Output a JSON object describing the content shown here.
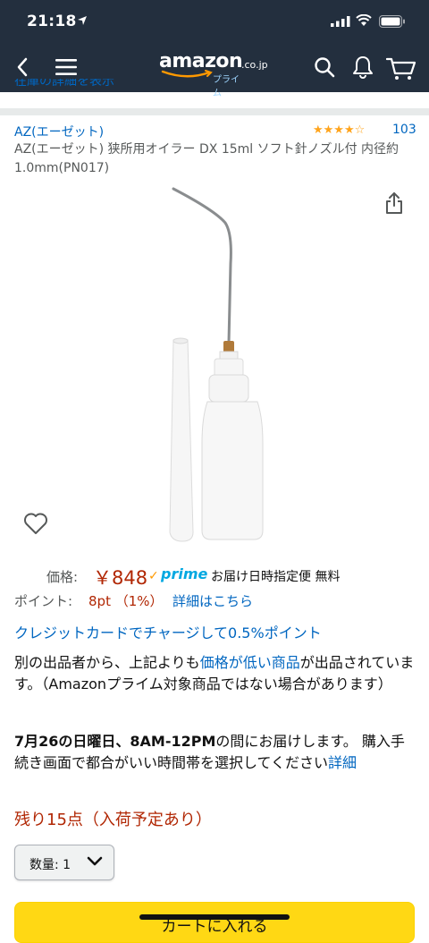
{
  "status_bar": {
    "time": "21:18"
  },
  "nav": {
    "logo_text": "amazon",
    "logo_tld": ".co.jp",
    "logo_sub": "プライム",
    "clipped_link": "在庫の詳細を表示"
  },
  "product": {
    "brand": "AZ(エーゼット)",
    "rating_stars": "★★★★☆",
    "rating_count": "103",
    "title": "AZ(エーゼット) 狭所用オイラー DX 15ml ソフト針ノズル付 内径約1.0mm(PN017)"
  },
  "price": {
    "label": "価格:",
    "value": "￥848",
    "prime_check": "✓",
    "prime_label": "prime",
    "delivery_note": "お届け日時指定便 無料"
  },
  "points": {
    "label": "ポイント:",
    "value": "8pt （1%）",
    "details_link": "詳細はこちら"
  },
  "credit_link": "クレジットカードでチャージして0.5%ポイント",
  "other_sellers": {
    "text_before": "別の出品者から、上記よりも",
    "link": "価格が低い商品",
    "text_after": "が出品されています。（Amazonプライム対象商品ではない場合があります）"
  },
  "delivery": {
    "date_bold": "7月26の日曜日、8AM-12PM",
    "text": "の間にお届けします。 購入手続き画面で都合がいい時間帯を選択してください",
    "link": "詳細"
  },
  "stock": "残り15点（入荷予定あり）",
  "quantity": {
    "label": "数量: 1"
  },
  "cart_button": "カートに入れる",
  "colors": {
    "header": "#232f3e",
    "link": "#0066c0",
    "price": "#b12704",
    "star": "#ffa41c",
    "cart": "#ffd814"
  }
}
